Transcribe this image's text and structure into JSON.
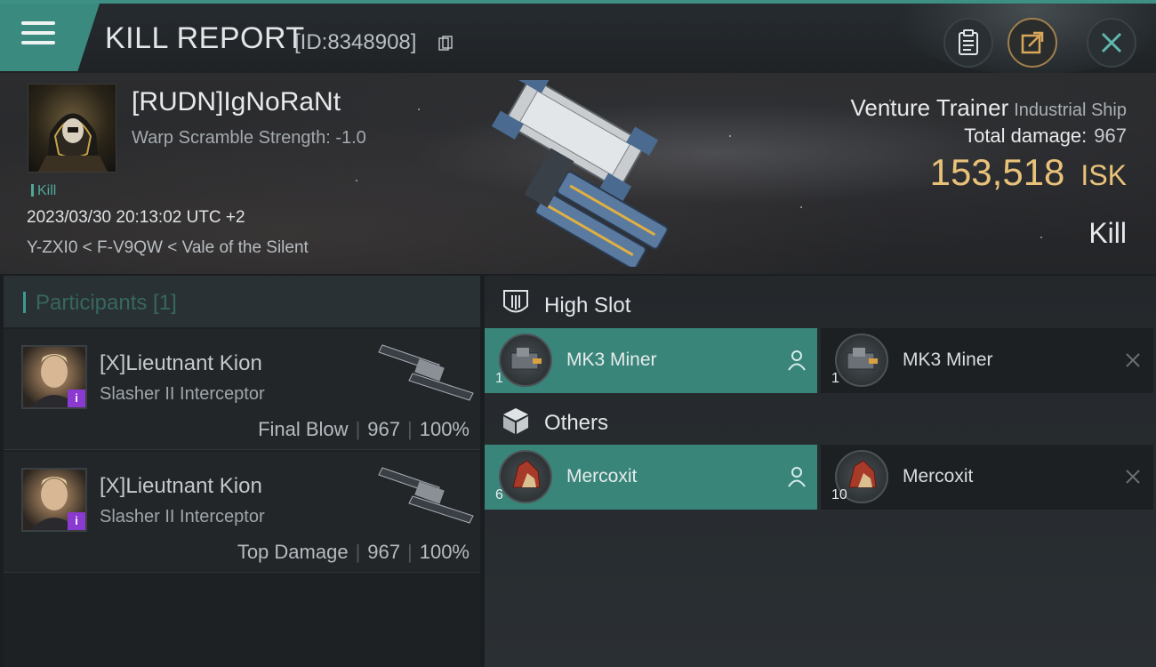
{
  "header": {
    "title": "KILL REPORT",
    "report_id": "[ID:8348908]"
  },
  "victim": {
    "name": "[RUDN]IgNoRaNt",
    "warp_scramble": "Warp Scramble Strength: -1.0",
    "tag": "Kill",
    "datetime": "2023/03/30 20:13:02 UTC +2",
    "location": "Y-ZXI0 < F-V9QW < Vale of the Silent",
    "ship_name": "Venture Trainer",
    "ship_class": "Industrial Ship",
    "total_damage_label": "Total damage:",
    "total_damage": "967",
    "isk_amount": "153,518",
    "isk_unit": "ISK",
    "result": "Kill"
  },
  "participants": {
    "title": "Participants [1]",
    "items": [
      {
        "name": "[X]Lieutnant Kion",
        "ship": "Slasher II Interceptor",
        "role": "Final Blow",
        "damage": "967",
        "percent": "100%",
        "badge": "i"
      },
      {
        "name": "[X]Lieutnant Kion",
        "ship": "Slasher II Interceptor",
        "role": "Top Damage",
        "damage": "967",
        "percent": "100%",
        "badge": "i"
      }
    ]
  },
  "sections": {
    "high_slot": {
      "title": "High Slot",
      "items": [
        {
          "name": "MK3 Miner",
          "qty": "1",
          "state": "dropped"
        },
        {
          "name": "MK3 Miner",
          "qty": "1",
          "state": "destroyed"
        }
      ]
    },
    "others": {
      "title": "Others",
      "items": [
        {
          "name": "Mercoxit",
          "qty": "6",
          "state": "dropped"
        },
        {
          "name": "Mercoxit",
          "qty": "10",
          "state": "destroyed"
        }
      ]
    }
  },
  "colors": {
    "accent_teal": "#3a857a",
    "isk_gold": "#e9c27a",
    "badge_purple": "#8a3ad0"
  }
}
